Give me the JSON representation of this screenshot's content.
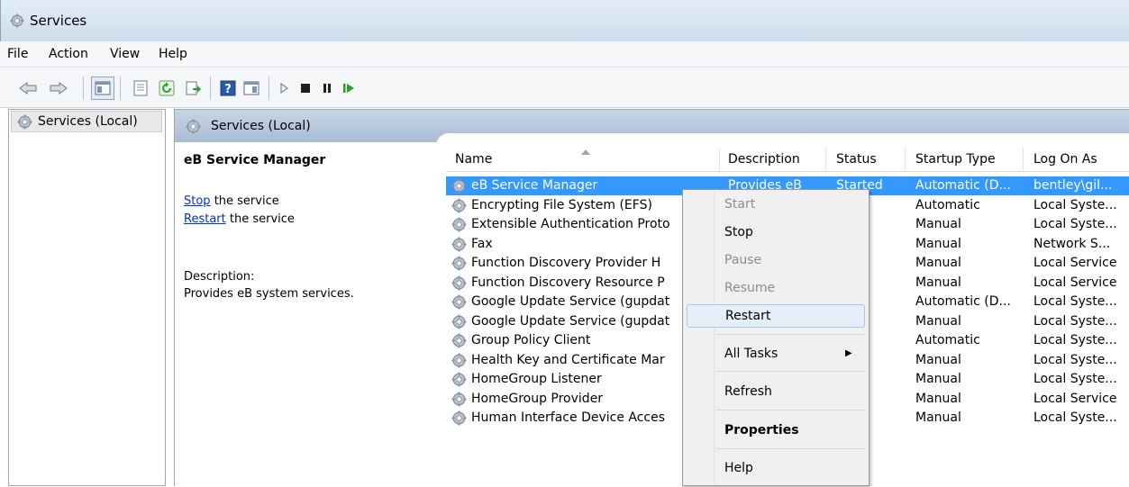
{
  "window": {
    "title": "Services"
  },
  "menu": {
    "file": "File",
    "action": "Action",
    "view": "View",
    "help": "Help"
  },
  "tree": {
    "root": "Services (Local)"
  },
  "pane": {
    "title": "Services (Local)"
  },
  "detail": {
    "service_name": "eB Service Manager",
    "stop_link": "Stop",
    "stop_suffix": " the service",
    "restart_link": "Restart",
    "restart_suffix": " the service",
    "description_label": "Description:",
    "description_text": "Provides eB system services."
  },
  "columns": {
    "name": "Name",
    "description": "Description",
    "status": "Status",
    "startup": "Startup Type",
    "logon": "Log On As"
  },
  "rows": [
    {
      "name": "eB Service Manager",
      "description": "Provides eB",
      "status": "Started",
      "startup": "Automatic (D...",
      "logon": "bentley\\gil..."
    },
    {
      "name": "Encrypting File System (EFS)",
      "description": "",
      "status": "ed",
      "startup": "Automatic",
      "logon": "Local Syste..."
    },
    {
      "name": "Extensible Authentication Proto",
      "description": "",
      "status": "",
      "startup": "Manual",
      "logon": "Local Syste..."
    },
    {
      "name": "Fax",
      "description": "",
      "status": "",
      "startup": "Manual",
      "logon": "Network S..."
    },
    {
      "name": "Function Discovery Provider H",
      "description": "",
      "status": "ed",
      "startup": "Manual",
      "logon": "Local Service"
    },
    {
      "name": "Function Discovery Resource P",
      "description": "",
      "status": "",
      "startup": "Manual",
      "logon": "Local Service"
    },
    {
      "name": "Google Update Service (gupdat",
      "description": "",
      "status": "",
      "startup": "Automatic (D...",
      "logon": "Local Syste..."
    },
    {
      "name": "Google Update Service (gupdat",
      "description": "",
      "status": "",
      "startup": "Manual",
      "logon": "Local Syste..."
    },
    {
      "name": "Group Policy Client",
      "description": "",
      "status": "ed",
      "startup": "Automatic",
      "logon": "Local Syste..."
    },
    {
      "name": "Health Key and Certificate Mar",
      "description": "",
      "status": "",
      "startup": "Manual",
      "logon": "Local Syste..."
    },
    {
      "name": "HomeGroup Listener",
      "description": "",
      "status": "",
      "startup": "Manual",
      "logon": "Local Syste..."
    },
    {
      "name": "HomeGroup Provider",
      "description": "",
      "status": "",
      "startup": "Manual",
      "logon": "Local Service"
    },
    {
      "name": "Human Interface Device Acces",
      "description": "",
      "status": "ed",
      "startup": "Manual",
      "logon": "Local Syste..."
    }
  ],
  "context_menu": {
    "start": "Start",
    "stop": "Stop",
    "pause": "Pause",
    "resume": "Resume",
    "restart": "Restart",
    "all_tasks": "All Tasks",
    "refresh": "Refresh",
    "properties": "Properties",
    "help": "Help",
    "submenu_arrow": "▶"
  },
  "colors": {
    "selection": "#3399ff",
    "link": "#0033cc",
    "play": "#2a9d2a"
  }
}
